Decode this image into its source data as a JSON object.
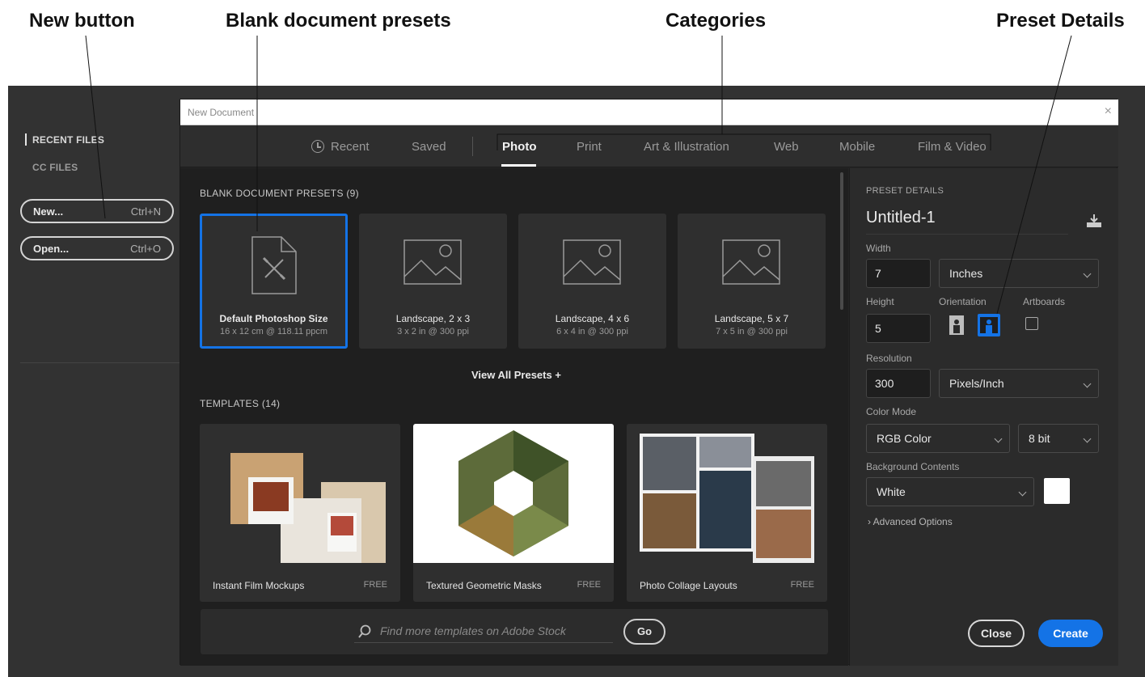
{
  "callouts": {
    "new_button": "New button",
    "blank_presets": "Blank document presets",
    "categories": "Categories",
    "preset_details": "Preset Details"
  },
  "left_panel": {
    "recent_files": "RECENT FILES",
    "cc_files": "CC FILES",
    "new_label": "New...",
    "new_shortcut": "Ctrl+N",
    "open_label": "Open...",
    "open_shortcut": "Ctrl+O"
  },
  "dialog": {
    "title": "New Document",
    "close_glyph": "×",
    "tabs": [
      {
        "label": "Recent"
      },
      {
        "label": "Saved"
      },
      {
        "label": "Photo"
      },
      {
        "label": "Print"
      },
      {
        "label": "Art & Illustration"
      },
      {
        "label": "Web"
      },
      {
        "label": "Mobile"
      },
      {
        "label": "Film & Video"
      }
    ],
    "active_tab": "Photo"
  },
  "presets_section": {
    "heading": "BLANK DOCUMENT PRESETS",
    "count": "(9)",
    "items": [
      {
        "title": "Default Photoshop Size",
        "subtitle": "16 x 12 cm @ 118.11 ppcm",
        "icon": "document-icon"
      },
      {
        "title": "Landscape, 2 x 3",
        "subtitle": "3 x 2 in @ 300 ppi",
        "icon": "image-icon"
      },
      {
        "title": "Landscape, 4 x 6",
        "subtitle": "6 x 4 in @ 300 ppi",
        "icon": "image-icon"
      },
      {
        "title": "Landscape, 5 x 7",
        "subtitle": "7 x 5 in @ 300 ppi",
        "icon": "image-icon"
      }
    ],
    "view_all": "View All Presets",
    "view_all_glyph": "+"
  },
  "templates_section": {
    "heading": "TEMPLATES",
    "count": "(14)",
    "items": [
      {
        "name": "Instant Film Mockups",
        "price": "FREE"
      },
      {
        "name": "Textured Geometric Masks",
        "price": "FREE"
      },
      {
        "name": "Photo Collage Layouts",
        "price": "FREE"
      }
    ]
  },
  "stock_search": {
    "placeholder": "Find more templates on Adobe Stock",
    "go_label": "Go"
  },
  "preset_details": {
    "heading": "PRESET DETAILS",
    "doc_name": "Untitled-1",
    "width_label": "Width",
    "width_value": "7",
    "width_unit": "Inches",
    "height_label": "Height",
    "height_value": "5",
    "orientation_label": "Orientation",
    "orientation_selected": "landscape",
    "artboards_label": "Artboards",
    "artboards_checked": false,
    "resolution_label": "Resolution",
    "resolution_value": "300",
    "resolution_unit": "Pixels/Inch",
    "color_mode_label": "Color Mode",
    "color_mode_value": "RGB Color",
    "bit_depth_value": "8 bit",
    "background_label": "Background Contents",
    "background_value": "White",
    "background_swatch": "#ffffff",
    "advanced_label": "Advanced Options",
    "close_label": "Close",
    "create_label": "Create"
  },
  "colors": {
    "accent": "#1473e6",
    "panel": "#2b2b2b",
    "main": "#1f1f1f"
  }
}
